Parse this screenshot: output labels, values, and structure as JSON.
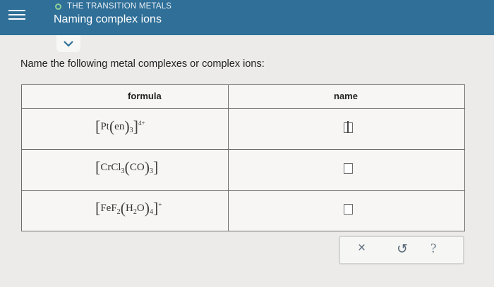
{
  "header": {
    "section": "THE TRANSITION METALS",
    "title": "Naming complex ions",
    "menu_icon": "hamburger-icon",
    "status_icon": "circle-outline-icon",
    "colors": {
      "bar": "#2f6f98",
      "status": "#8fd19a"
    }
  },
  "collapse_icon": "chevron-down-icon",
  "question": "Name the following metal complexes or complex ions:",
  "table": {
    "headers": {
      "formula": "formula",
      "name": "name"
    },
    "rows": [
      {
        "metal": "Pt",
        "ligand": "en",
        "ligand_sub": "3",
        "charge": "4+"
      },
      {
        "metal": "Cr",
        "group": "Cl",
        "group_sub": "3",
        "ligand": "CO",
        "ligand_sub": "3"
      },
      {
        "metal": "Fe",
        "group": "F",
        "group_sub": "2",
        "ligand_a": "H",
        "ligand_a_sub": "2",
        "ligand_b": "O",
        "ligand_sub": "4",
        "charge": "+"
      }
    ]
  },
  "actions": {
    "clear": "×",
    "undo": "↺",
    "help": "?"
  }
}
